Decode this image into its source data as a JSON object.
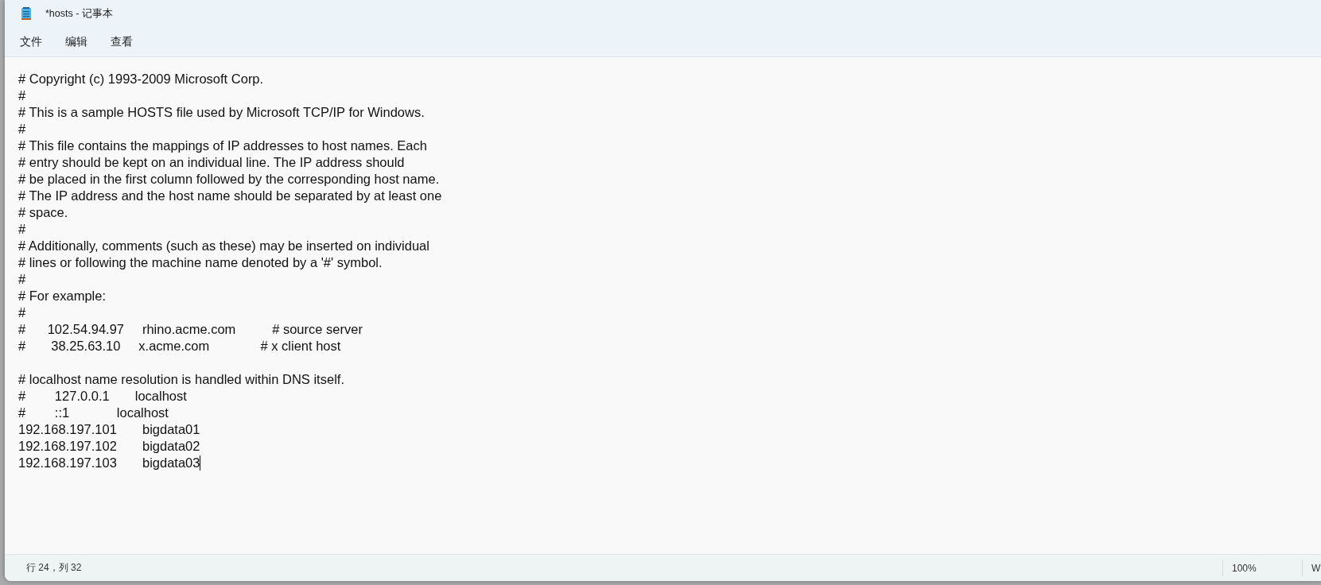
{
  "window": {
    "title": "*hosts - 记事本"
  },
  "menu": [
    {
      "label": "文件"
    },
    {
      "label": "编辑"
    },
    {
      "label": "查看"
    }
  ],
  "editor": {
    "lines": [
      {
        "kind": "text",
        "text": "# Copyright (c) 1993-2009 Microsoft Corp."
      },
      {
        "kind": "text",
        "text": "#"
      },
      {
        "kind": "text",
        "text": "# This is a sample HOSTS file used by Microsoft TCP/IP for Windows."
      },
      {
        "kind": "text",
        "text": "#"
      },
      {
        "kind": "text",
        "text": "# This file contains the mappings of IP addresses to host names. Each"
      },
      {
        "kind": "text",
        "text": "# entry should be kept on an individual line. The IP address should"
      },
      {
        "kind": "text",
        "text": "# be placed in the first column followed by the corresponding host name."
      },
      {
        "kind": "text",
        "text": "# The IP address and the host name should be separated by at least one"
      },
      {
        "kind": "text",
        "text": "# space."
      },
      {
        "kind": "text",
        "text": "#"
      },
      {
        "kind": "text",
        "text": "# Additionally, comments (such as these) may be inserted on individual"
      },
      {
        "kind": "text",
        "text": "# lines or following the machine name denoted by a '#' symbol."
      },
      {
        "kind": "text",
        "text": "#"
      },
      {
        "kind": "text",
        "text": "# For example:"
      },
      {
        "kind": "text",
        "text": "#"
      },
      {
        "kind": "text",
        "text": "#      102.54.94.97     rhino.acme.com          # source server"
      },
      {
        "kind": "text",
        "text": "#       38.25.63.10     x.acme.com              # x client host"
      },
      {
        "kind": "blank"
      },
      {
        "kind": "text",
        "text": "# localhost name resolution is handled within DNS itself."
      },
      {
        "kind": "text",
        "text": "#        127.0.0.1       localhost"
      },
      {
        "kind": "text",
        "text": "#        ::1             localhost"
      },
      {
        "kind": "text",
        "text": "192.168.197.101       bigdata01"
      },
      {
        "kind": "text",
        "text": "192.168.197.102       bigdata02"
      },
      {
        "kind": "text",
        "text": "192.168.197.103       bigdata03",
        "caret": true
      }
    ]
  },
  "status_bar": {
    "position": "行 24，列 32",
    "zoom": "100%",
    "encoding": "W"
  }
}
